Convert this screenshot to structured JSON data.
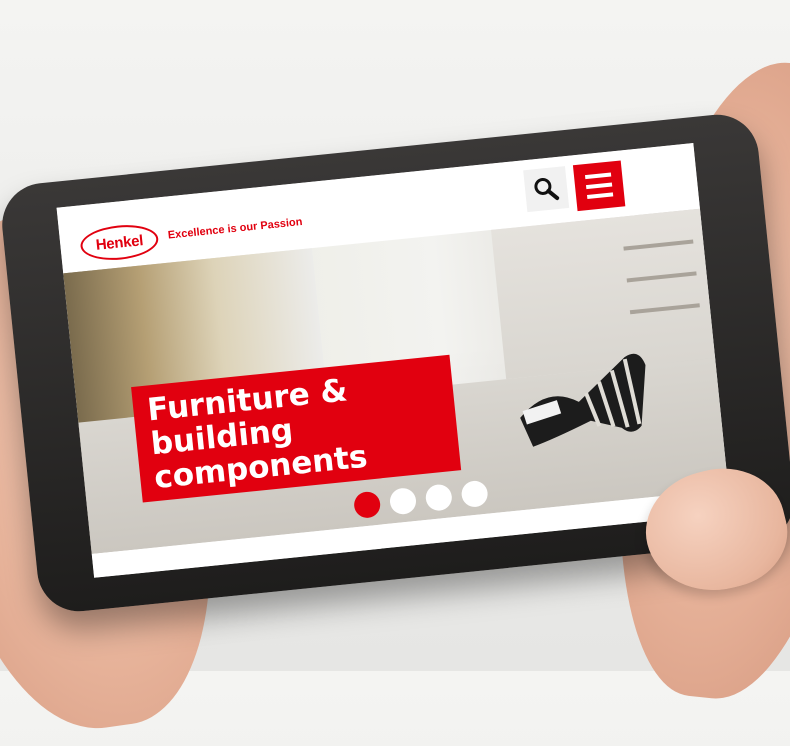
{
  "brand": {
    "logo_text": "Henkel",
    "tagline": "Excellence is our Passion",
    "accent_color": "#e1000f"
  },
  "header": {
    "search_icon": "search-icon",
    "menu_icon": "hamburger-menu-icon"
  },
  "hero": {
    "headline_line1": "Furniture & building",
    "headline_line2": "components",
    "carousel": {
      "total_slides": 4,
      "active_index": 0
    }
  }
}
